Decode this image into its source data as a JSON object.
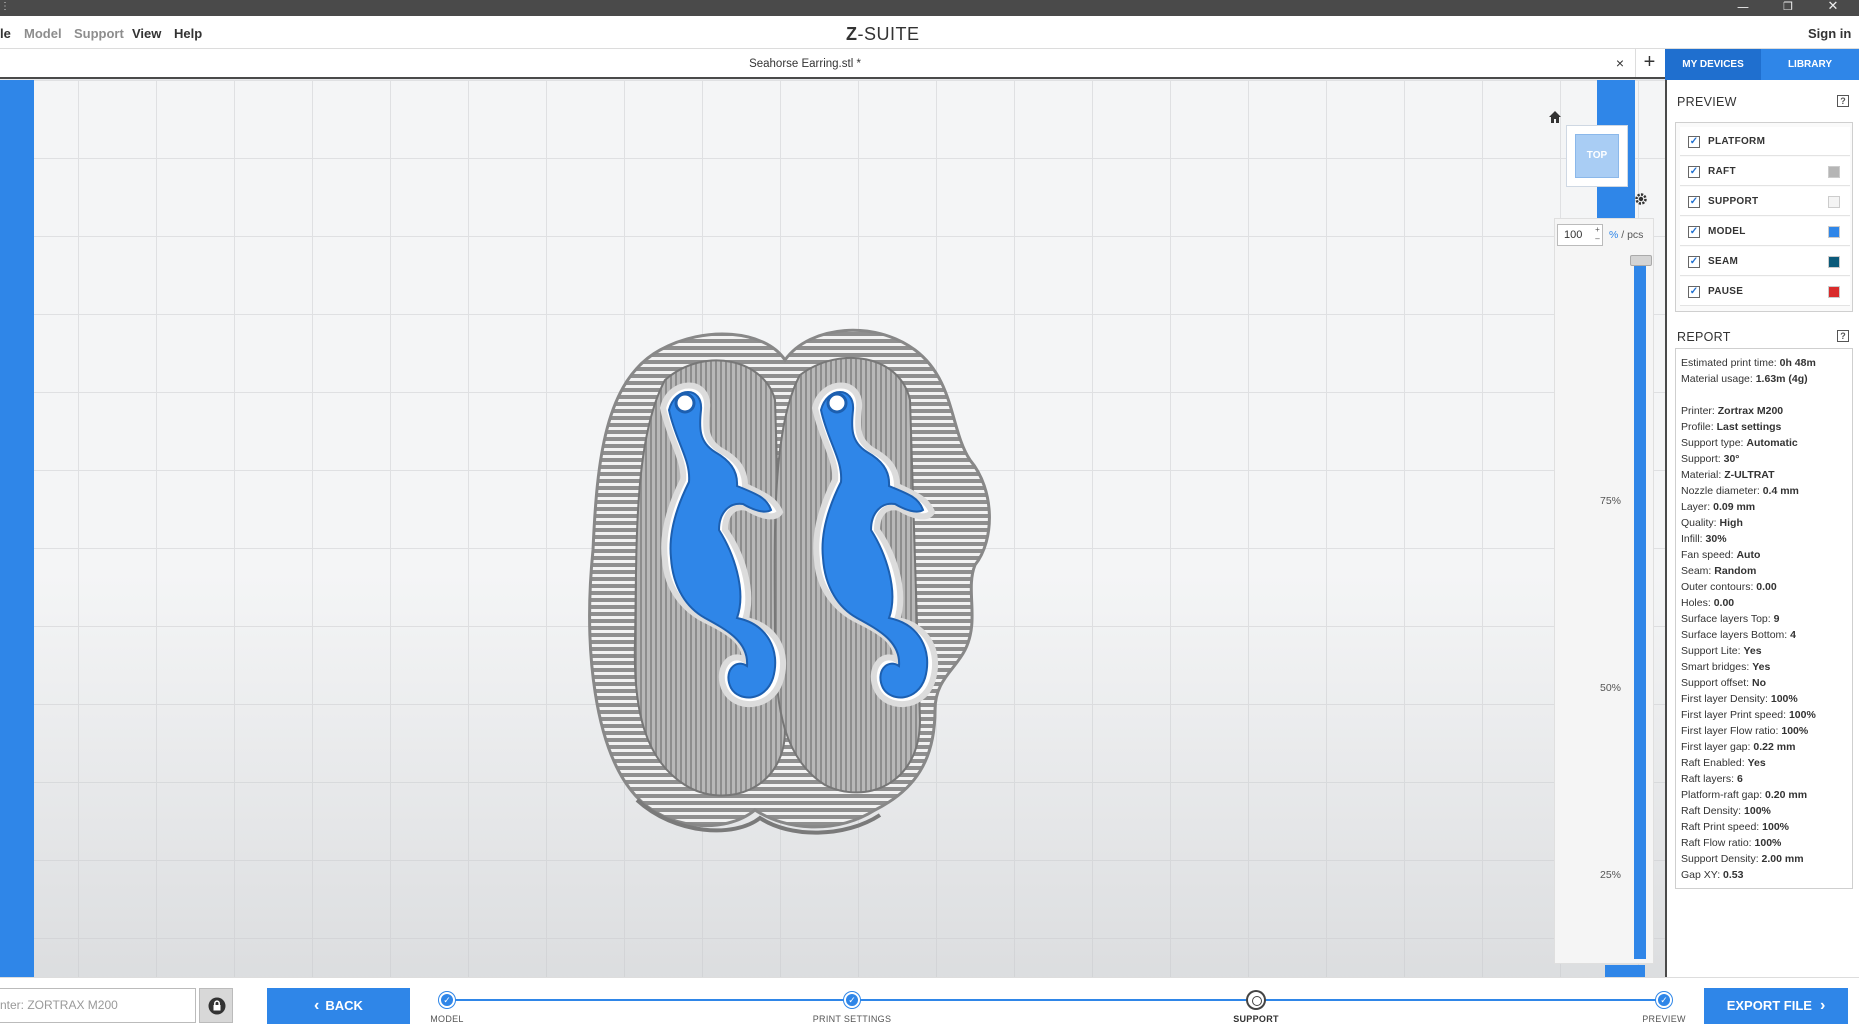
{
  "app": {
    "logo_prefix": "Z",
    "logo_rest": "-SUITE",
    "title_mark": "⋮"
  },
  "window": {
    "minimize": "—",
    "maximize": "❐",
    "close": "✕"
  },
  "menu": {
    "file": "le",
    "model": "Model",
    "support": "Support",
    "view": "View",
    "help": "Help",
    "signin": "Sign in"
  },
  "tabs": {
    "file_tab": "Seahorse Earring.stl *",
    "close": "×",
    "add": "+"
  },
  "device_tabs": {
    "my_devices": "MY DEVICES",
    "library": "LIBRARY"
  },
  "viewcube": {
    "face": "TOP"
  },
  "layers": {
    "value": "100",
    "unit_pct": "%",
    "unit_sep": " / pcs",
    "ticks": [
      "75%",
      "50%",
      "25%"
    ],
    "spin_up": "+",
    "spin_down": "–",
    "level": 1.0
  },
  "preview": {
    "title": "PREVIEW",
    "help": "?",
    "items": [
      {
        "label": "PLATFORM",
        "checked": true,
        "color": ""
      },
      {
        "label": "RAFT",
        "checked": true,
        "color": "#b5b5b5"
      },
      {
        "label": "SUPPORT",
        "checked": true,
        "color": "#f4f4f4"
      },
      {
        "label": "MODEL",
        "checked": true,
        "color": "#2f86e8"
      },
      {
        "label": "SEAM",
        "checked": true,
        "color": "#0b5a7a"
      },
      {
        "label": "PAUSE",
        "checked": true,
        "color": "#d92b2b"
      }
    ],
    "check_mark": "✓"
  },
  "report": {
    "title": "REPORT",
    "help": "?",
    "summary": [
      {
        "k": "Estimated print time:",
        "v": "0h 48m"
      },
      {
        "k": "Material usage:",
        "v": "1.63m (4g)"
      }
    ],
    "details": [
      {
        "k": "Printer:",
        "v": "Zortrax M200"
      },
      {
        "k": "Profile:",
        "v": "Last settings"
      },
      {
        "k": "Support type:",
        "v": "Automatic"
      },
      {
        "k": "Support:",
        "v": "30°"
      },
      {
        "k": "Material:",
        "v": "Z-ULTRAT"
      },
      {
        "k": "Nozzle diameter:",
        "v": "0.4 mm"
      },
      {
        "k": "Layer:",
        "v": "0.09 mm"
      },
      {
        "k": "Quality:",
        "v": "High"
      },
      {
        "k": "Infill:",
        "v": "30%"
      },
      {
        "k": "Fan speed:",
        "v": "Auto"
      },
      {
        "k": "Seam:",
        "v": "Random"
      },
      {
        "k": "Outer contours:",
        "v": "0.00"
      },
      {
        "k": "Holes:",
        "v": "0.00"
      },
      {
        "k": "Surface layers Top:",
        "v": "9"
      },
      {
        "k": "Surface layers Bottom:",
        "v": "4"
      },
      {
        "k": "Support Lite:",
        "v": "Yes"
      },
      {
        "k": "Smart bridges:",
        "v": "Yes"
      },
      {
        "k": "Support offset:",
        "v": "No"
      },
      {
        "k": "First layer Density:",
        "v": "100%"
      },
      {
        "k": "First layer Print speed:",
        "v": "100%"
      },
      {
        "k": "First layer Flow ratio:",
        "v": "100%"
      },
      {
        "k": "First layer gap:",
        "v": "0.22 mm"
      },
      {
        "k": "Raft Enabled:",
        "v": "Yes"
      },
      {
        "k": "Raft layers:",
        "v": "6"
      },
      {
        "k": "Platform-raft gap:",
        "v": "0.20 mm"
      },
      {
        "k": "Raft Density:",
        "v": "100%"
      },
      {
        "k": "Raft Print speed:",
        "v": "100%"
      },
      {
        "k": "Raft Flow ratio:",
        "v": "100%"
      },
      {
        "k": "Support Density:",
        "v": "2.00 mm"
      },
      {
        "k": "Gap XY:",
        "v": "0.53"
      }
    ]
  },
  "bottom": {
    "printer_text": "nter: ZORTRAX M200",
    "back": "BACK",
    "back_icon": "‹",
    "export": "EXPORT FILE",
    "export_icon": "›",
    "steps": [
      {
        "label": "MODEL",
        "state": "done"
      },
      {
        "label": "PRINT SETTINGS",
        "state": "done"
      },
      {
        "label": "SUPPORT",
        "state": "open"
      },
      {
        "label": "PREVIEW",
        "state": "current"
      }
    ],
    "step_check": "✓"
  },
  "colors": {
    "accent": "#2f86e8",
    "accent_dark": "#1f6fcf",
    "model_blue": "#2f86e8",
    "raft_grey": "#9b9b9b"
  }
}
